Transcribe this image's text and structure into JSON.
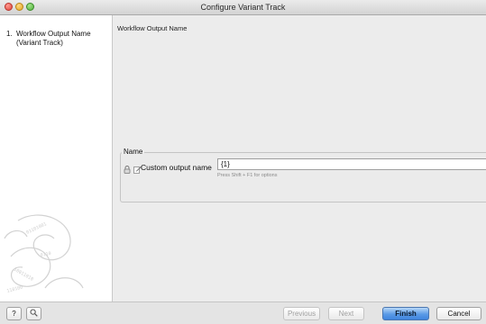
{
  "window": {
    "title": "Configure Variant Track"
  },
  "sidebar": {
    "steps": [
      {
        "number": "1.",
        "label_line1": "Workflow Output Name",
        "label_line2": "(Variant Track)"
      }
    ]
  },
  "main": {
    "section_title": "Workflow Output Name",
    "group": {
      "legend": "Name",
      "field_label": "Custom output name",
      "field_value": "{1}",
      "hint": "Press Shift + F1 for options"
    }
  },
  "footer": {
    "help_label": "?",
    "previous_label": "Previous",
    "next_label": "Next",
    "finish_label": "Finish",
    "cancel_label": "Cancel"
  },
  "icons": {
    "lock": "lock-icon",
    "edit": "pencil-icon",
    "zoom": "magnifier-icon"
  }
}
